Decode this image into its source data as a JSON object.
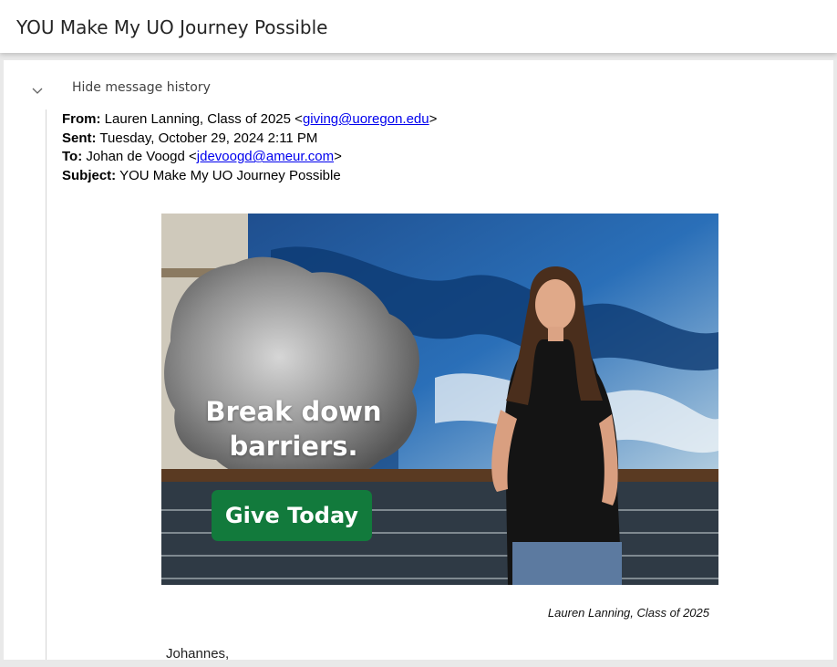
{
  "header": {
    "title": "YOU Make My UO Journey Possible"
  },
  "history_toggle": {
    "label": "Hide message history",
    "icon": "chevron-down-icon"
  },
  "message": {
    "from_label": "From:",
    "from_name": "Lauren Lanning, Class of 2025",
    "from_email": "giving@uoregon.edu",
    "sent_label": "Sent:",
    "sent_value": "Tuesday, October 29, 2024 2:11 PM",
    "to_label": "To:",
    "to_name": "Johan de Voogd",
    "to_email": "jdevoogd@ameur.com",
    "subject_label": "Subject:",
    "subject_value": "YOU Make My UO Journey Possible"
  },
  "hero": {
    "headline_line1": "Break down",
    "headline_line2": "barriers.",
    "cta_label": "Give Today",
    "cta_color": "#127a3c",
    "caption": "Lauren Lanning, Class of 2025"
  },
  "body": {
    "greeting": "Johannes,"
  },
  "colors": {
    "link": "#0000ee",
    "brand_green": "#127a3c"
  }
}
